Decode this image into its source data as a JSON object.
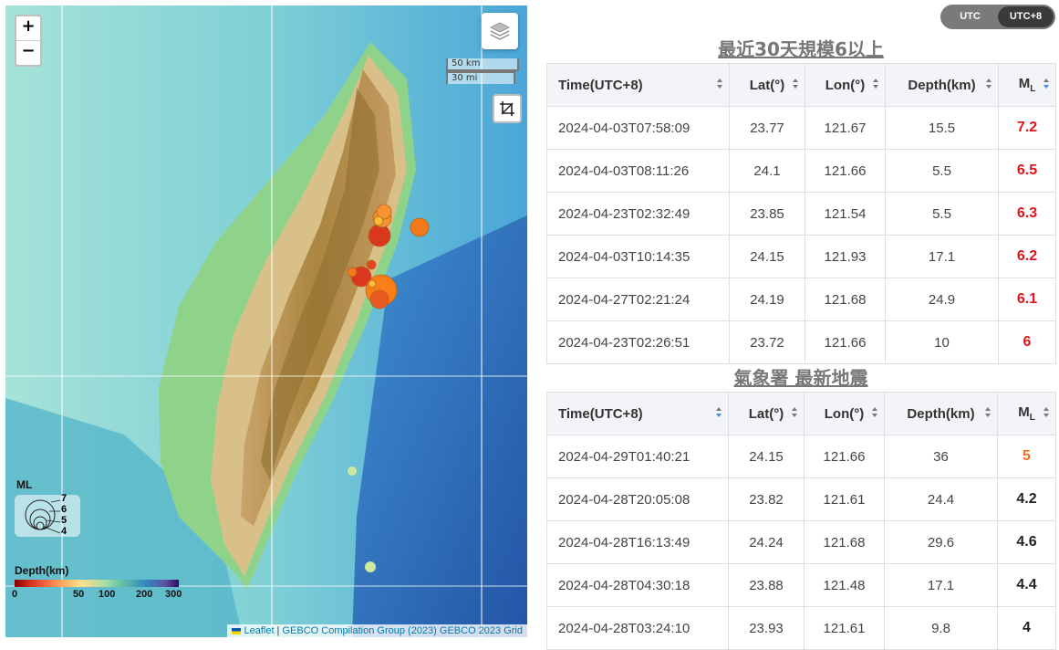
{
  "map": {
    "zoom_in": "+",
    "zoom_out": "−",
    "scale_km": "50 km",
    "scale_mi": "30 mi",
    "legend_ml_title": "ML",
    "legend_ml_values": [
      "7",
      "6",
      "5",
      "4"
    ],
    "depth_title": "Depth(km)",
    "depth_ticks": [
      "0",
      "50",
      "100",
      "200",
      "300"
    ],
    "attribution_leaflet": "Leaflet",
    "attribution_sep": " | ",
    "attribution_gebco": "GEBCO Compilation Group (2023) GEBCO 2023 Grid",
    "icons": [
      "layers-icon",
      "crop-icon"
    ]
  },
  "tz_toggle": {
    "options": [
      "UTC",
      "UTC+8"
    ],
    "selected": "UTC+8"
  },
  "section1": {
    "title": "最近30天規模6以上",
    "headers": {
      "time": "Time(UTC+8)",
      "lat": "Lat(°)",
      "lon": "Lon(°)",
      "depth": "Depth(km)",
      "ml": "M",
      "ml_sub": "L"
    },
    "rows": [
      {
        "time": "2024-04-03T07:58:09",
        "lat": "23.77",
        "lon": "121.67",
        "depth": "15.5",
        "ml": "7.2",
        "color": "#e0141c"
      },
      {
        "time": "2024-04-03T08:11:26",
        "lat": "24.1",
        "lon": "121.66",
        "depth": "5.5",
        "ml": "6.5",
        "color": "#e0141c"
      },
      {
        "time": "2024-04-23T02:32:49",
        "lat": "23.85",
        "lon": "121.54",
        "depth": "5.5",
        "ml": "6.3",
        "color": "#e0141c"
      },
      {
        "time": "2024-04-03T10:14:35",
        "lat": "24.15",
        "lon": "121.93",
        "depth": "17.1",
        "ml": "6.2",
        "color": "#e0141c"
      },
      {
        "time": "2024-04-27T02:21:24",
        "lat": "24.19",
        "lon": "121.68",
        "depth": "24.9",
        "ml": "6.1",
        "color": "#e0141c"
      },
      {
        "time": "2024-04-23T02:26:51",
        "lat": "23.72",
        "lon": "121.66",
        "depth": "10",
        "ml": "6",
        "color": "#e0141c"
      }
    ]
  },
  "section2": {
    "title": "氣象署 最新地震",
    "headers": {
      "time": "Time(UTC+8)",
      "lat": "Lat(°)",
      "lon": "Lon(°)",
      "depth": "Depth(km)",
      "ml": "M",
      "ml_sub": "L"
    },
    "rows": [
      {
        "time": "2024-04-29T01:40:21",
        "lat": "24.15",
        "lon": "121.66",
        "depth": "36",
        "ml": "5",
        "color": "#f36c21"
      },
      {
        "time": "2024-04-28T20:05:08",
        "lat": "23.82",
        "lon": "121.61",
        "depth": "24.4",
        "ml": "4.2",
        "color": "#222222"
      },
      {
        "time": "2024-04-28T16:13:49",
        "lat": "24.24",
        "lon": "121.68",
        "depth": "29.6",
        "ml": "4.6",
        "color": "#222222"
      },
      {
        "time": "2024-04-28T04:30:18",
        "lat": "23.88",
        "lon": "121.48",
        "depth": "17.1",
        "ml": "4.4",
        "color": "#222222"
      },
      {
        "time": "2024-04-28T03:24:10",
        "lat": "23.93",
        "lon": "121.61",
        "depth": "9.8",
        "ml": "4",
        "color": "#222222"
      }
    ]
  }
}
